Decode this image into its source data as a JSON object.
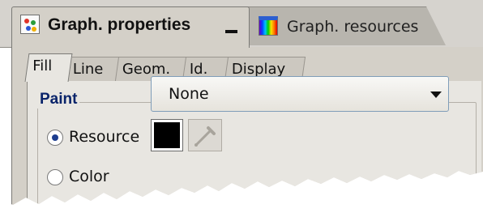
{
  "tabs": {
    "properties": {
      "label": "Graph. properties",
      "icon": "graph-properties-icon"
    },
    "resources": {
      "label": "Graph. resources",
      "icon": "graph-resources-icon"
    },
    "minimize_icon": "minimize-icon"
  },
  "subtabs": [
    "Fill",
    "Line",
    "Geom.",
    "Id.",
    "Display"
  ],
  "active_subtab": "Fill",
  "paint": {
    "group_title": "Paint",
    "resource_label": "Resource",
    "color_label": "Color",
    "selected_option": "resource",
    "resource_value": "None",
    "color_value": "#000000",
    "picker_icon": "eyedropper-icon"
  },
  "colors": {
    "accent_title": "#0a246a",
    "tab_bg": "#d4d0c8",
    "panel_bg": "#e8e6e1"
  }
}
